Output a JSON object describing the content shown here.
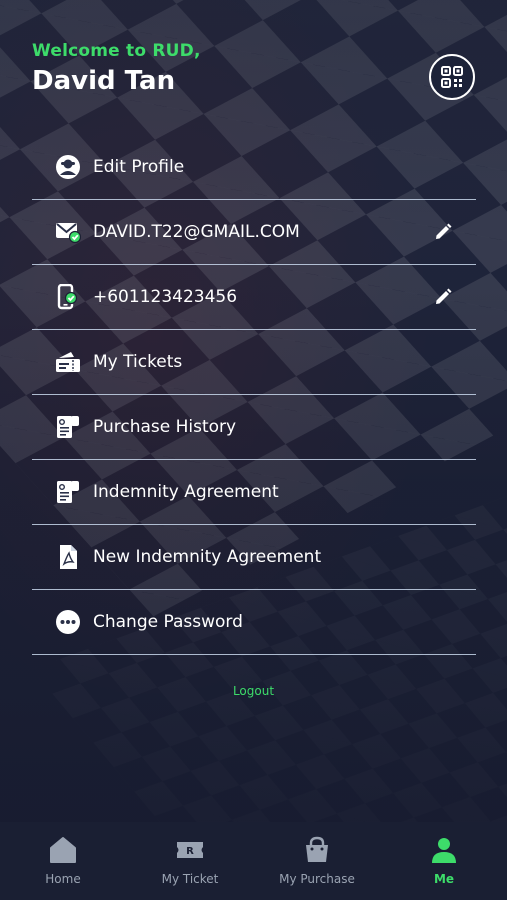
{
  "header": {
    "welcome": "Welcome to RUD,",
    "user_name": "David Tan",
    "qr_icon": "qr-code-icon"
  },
  "menu": {
    "items": [
      {
        "label": "Edit Profile",
        "icon": "user-avatar-icon"
      },
      {
        "label": "DAVID.T22@GMAIL.COM",
        "icon": "email-verified-icon",
        "edit_icon": "pencil-icon"
      },
      {
        "label": "+601123423456",
        "icon": "phone-verified-icon",
        "edit_icon": "pencil-icon"
      },
      {
        "label": "My Tickets",
        "icon": "tickets-icon"
      },
      {
        "label": "Purchase History",
        "icon": "receipt-icon"
      },
      {
        "label": "Indemnity Agreement",
        "icon": "document-icon"
      },
      {
        "label": "New Indemnity Agreement",
        "icon": "pdf-file-icon"
      },
      {
        "label": "Change Password",
        "icon": "more-dots-icon"
      }
    ]
  },
  "logout_label": "Logout",
  "tabbar": {
    "tabs": [
      {
        "label": "Home",
        "icon": "home-icon"
      },
      {
        "label": "My Ticket",
        "icon": "ticket-icon"
      },
      {
        "label": "My Purchase",
        "icon": "shopping-bag-icon"
      },
      {
        "label": "Me",
        "icon": "person-icon",
        "active": true
      }
    ]
  },
  "colors": {
    "accent": "#3ddc6a",
    "background": "#1b2033",
    "tabbar": "#1a1f33",
    "inactive_tab": "#9aa3b2"
  }
}
